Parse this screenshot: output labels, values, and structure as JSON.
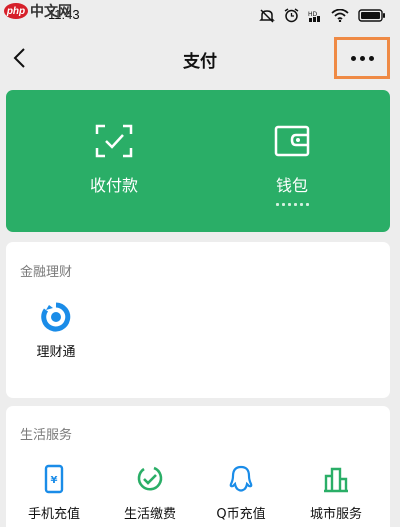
{
  "watermark": {
    "logo": "php",
    "text": "中文网"
  },
  "status_bar": {
    "time": "11:43",
    "icons": [
      "mute-icon",
      "alarm-icon",
      "hd-icon",
      "wifi-icon",
      "battery-icon"
    ]
  },
  "nav": {
    "title": "支付",
    "back_icon": "back-chevron-icon",
    "more_icon": "more-dots-icon",
    "highlight_color": "#ef8a45"
  },
  "wallet_card": {
    "color": "#2aae67",
    "items": [
      {
        "label": "收付款",
        "icon": "scan-pay-icon"
      },
      {
        "label": "钱包",
        "icon": "wallet-icon"
      }
    ]
  },
  "finance_section": {
    "title": "金融理财",
    "items": [
      {
        "label": "理财通",
        "icon": "licaitong-icon"
      }
    ]
  },
  "life_section": {
    "title": "生活服务",
    "items": [
      {
        "label": "手机充值",
        "icon": "phone-recharge-icon"
      },
      {
        "label": "生活缴费",
        "icon": "bill-payment-icon"
      },
      {
        "label": "Q币充值",
        "icon": "qcoin-icon"
      },
      {
        "label": "城市服务",
        "icon": "city-service-icon"
      }
    ]
  }
}
